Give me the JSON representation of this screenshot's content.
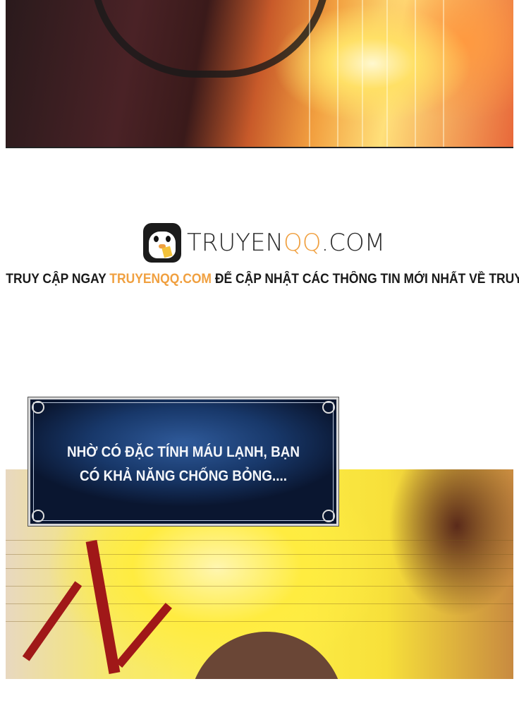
{
  "watermark": {
    "logo_text_prefix": "TRUYEN",
    "logo_text_highlight": "QQ",
    "logo_text_suffix": ".COM",
    "banner_prefix": "TRUY CẬP NGAY ",
    "banner_link": "TRUYENQQ.COM",
    "banner_suffix": " ĐỂ CẬP NHẬT CÁC THÔNG TIN MỚI NHẤT VỀ TRUYỆN",
    "accent_color": "#f0a040"
  },
  "caption": {
    "line1": "NHỜ CÓ ĐẶC TÍNH MÁU LẠNH, BẠN",
    "line2": "CÓ KHẢ NĂNG CHỐNG BỎNG...."
  }
}
